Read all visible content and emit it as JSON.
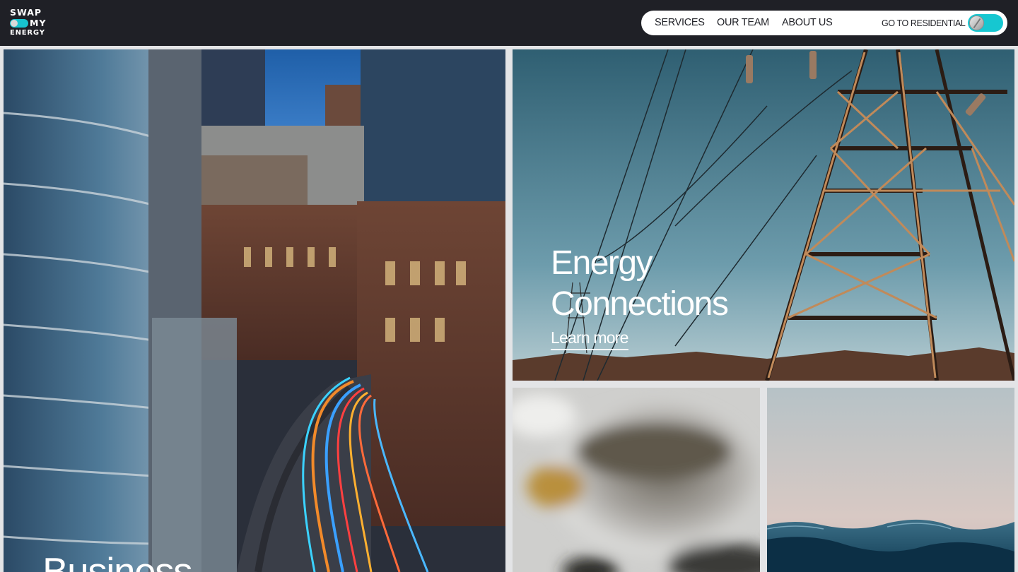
{
  "brand": {
    "logo_line1": "SWAP",
    "logo_line2": "MY",
    "logo_line3": "ENERGY"
  },
  "nav": {
    "services": "SERVICES",
    "team": "OUR TEAM",
    "about": "ABOUT US",
    "residential": "GO TO RESIDENTIAL"
  },
  "tiles": {
    "business": {
      "title": "Business"
    },
    "energy": {
      "title_line1": "Energy",
      "title_line2": "Connections",
      "cta": "Learn more"
    }
  },
  "colors": {
    "header_bg": "#1f2026",
    "accent": "#16c7d1",
    "page_bg": "#e3e4e6"
  }
}
